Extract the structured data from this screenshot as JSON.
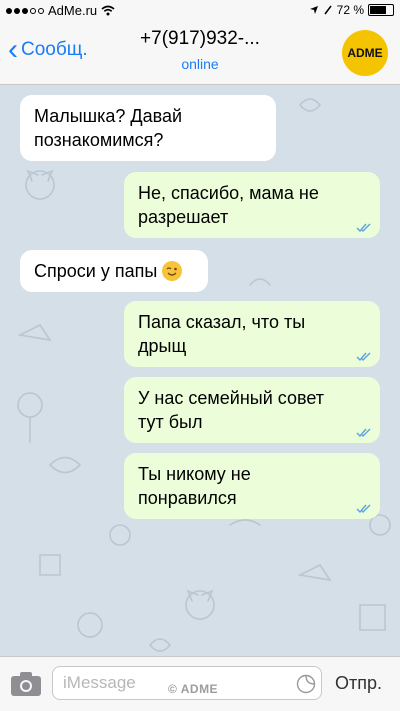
{
  "status_bar": {
    "carrier": "AdMe.ru",
    "battery_level": "72 %",
    "signal_bars": 3,
    "signal_total": 5,
    "battery_fraction": 0.72
  },
  "header": {
    "back_label": "Сообщ.",
    "contact_name": "+7(917)932-...",
    "contact_status": "online",
    "avatar_text": "ADME",
    "avatar_color": "#f5c400"
  },
  "messages": [
    {
      "direction": "in",
      "text": "Малышка? Давай познакомимся?"
    },
    {
      "direction": "out",
      "text": "Не, спасибо, мама не разрешает",
      "read": true
    },
    {
      "direction": "in",
      "text": "Спроси у папы",
      "emoji": "winking-face"
    },
    {
      "direction": "out",
      "text": "Папа сказал, что ты дрыщ",
      "read": true
    },
    {
      "direction": "out",
      "text": "У нас семейный совет тут был",
      "read": true
    },
    {
      "direction": "out",
      "text": "Ты никому не понравился",
      "read": true
    }
  ],
  "input_bar": {
    "placeholder": "iMessage",
    "send_label": "Отпр."
  },
  "watermark": "© ADME",
  "colors": {
    "accent": "#1a7cf6",
    "outgoing_bubble": "#ebfed9",
    "incoming_bubble": "#ffffff",
    "chat_background": "#d4dfe8",
    "read_ticks": "#5aa3e0"
  }
}
